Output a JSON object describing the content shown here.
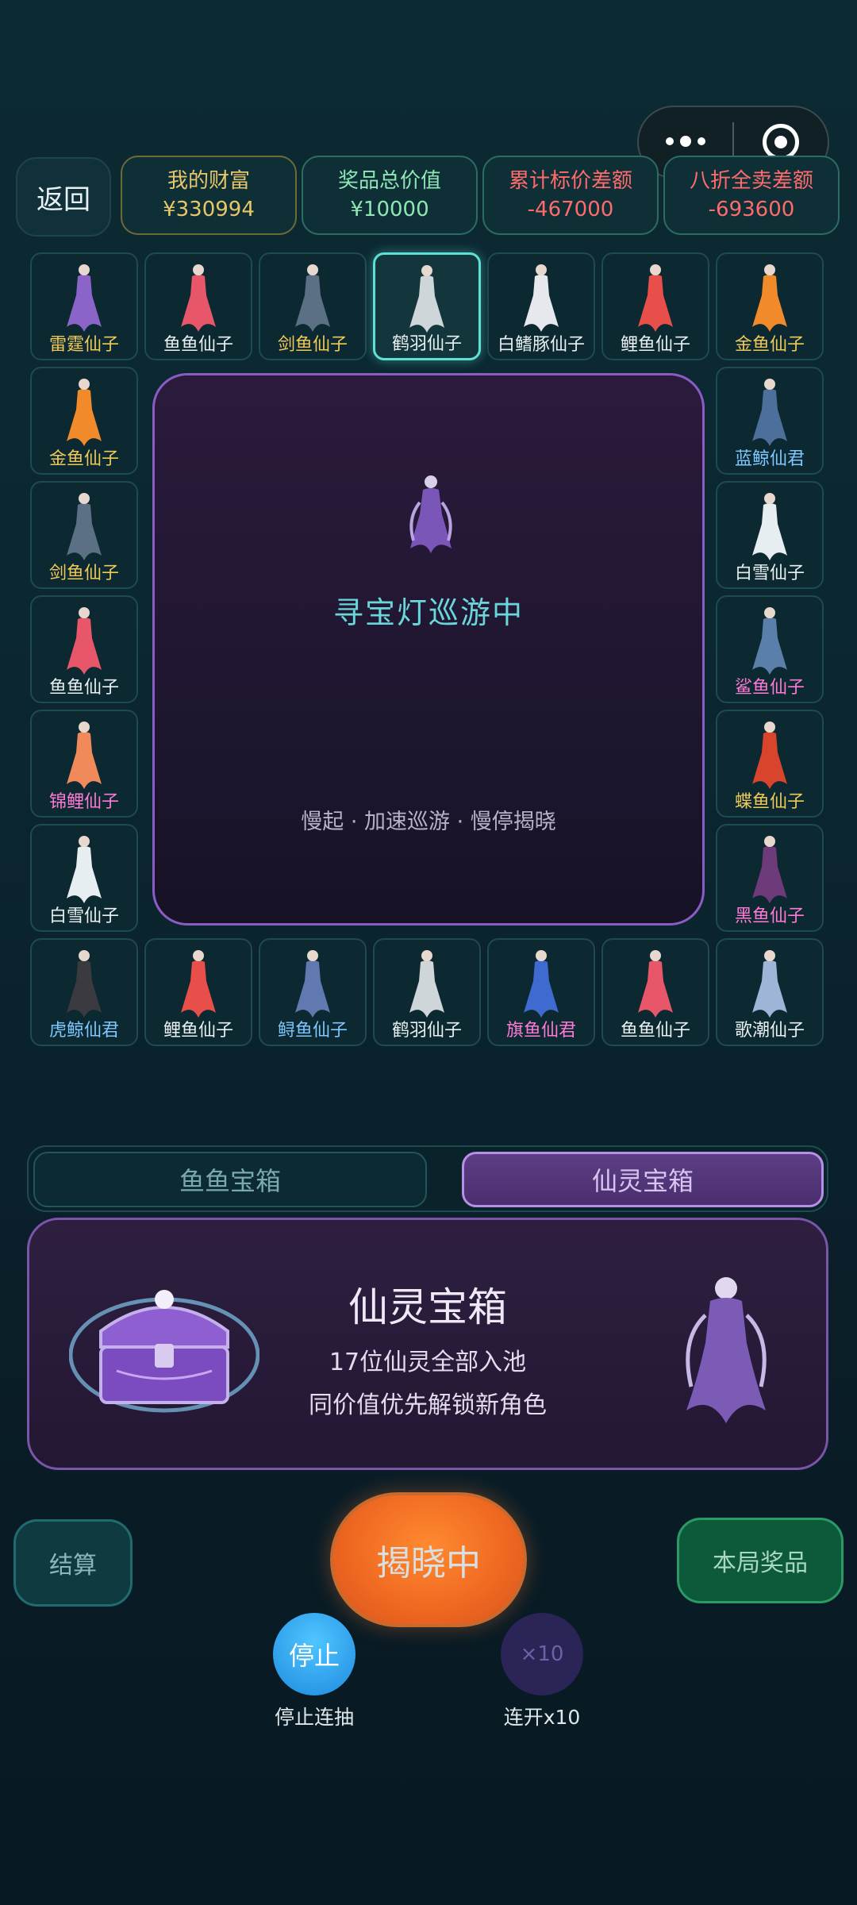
{
  "header": {
    "back_label": "返回",
    "stats": [
      {
        "label": "我的财富",
        "value": "¥330994"
      },
      {
        "label": "奖品总价值",
        "value": "¥10000"
      },
      {
        "label": "累计标价差额",
        "value": "-467000"
      },
      {
        "label": "八折全卖差额",
        "value": "-693600"
      }
    ]
  },
  "board": {
    "tiles": [
      {
        "name": "雷霆仙子",
        "color": "#f0c95a",
        "fig": "#8b64c9",
        "active": false
      },
      {
        "name": "鱼鱼仙子",
        "color": "#e9f1f2",
        "fig": "#e8566a",
        "active": false
      },
      {
        "name": "剑鱼仙子",
        "color": "#f0c95a",
        "fig": "#5b6f85",
        "active": false
      },
      {
        "name": "鹤羽仙子",
        "color": "#e9f1f2",
        "fig": "#cfd6da",
        "active": true
      },
      {
        "name": "白鳍豚仙子",
        "color": "#e9f1f2",
        "fig": "#e7e7ee",
        "active": false
      },
      {
        "name": "鲤鱼仙子",
        "color": "#e9f1f2",
        "fig": "#e84f4a",
        "active": false
      },
      {
        "name": "金鱼仙子",
        "color": "#f0c95a",
        "fig": "#f08a2a",
        "active": false
      },
      {
        "name": "蓝鲸仙君",
        "color": "#7ec8ff",
        "fig": "#4d6f9c",
        "active": false
      },
      {
        "name": "白雪仙子",
        "color": "#e9f1f2",
        "fig": "#e6eef2",
        "active": false
      },
      {
        "name": "鲨鱼仙子",
        "color": "#ff7ad6",
        "fig": "#5a7fa8",
        "active": false
      },
      {
        "name": "蝶鱼仙子",
        "color": "#f0c95a",
        "fig": "#d8452c",
        "active": false
      },
      {
        "name": "黑鱼仙子",
        "color": "#ff7ad6",
        "fig": "#6d3a7a",
        "active": false
      },
      {
        "name": "歌潮仙子",
        "color": "#e9f1f2",
        "fig": "#9fb5d8",
        "active": false
      },
      {
        "name": "鱼鱼仙子",
        "color": "#e9f1f2",
        "fig": "#e8566a",
        "active": false
      },
      {
        "name": "旗鱼仙君",
        "color": "#ff7ad6",
        "fig": "#3f6bd0",
        "active": false
      },
      {
        "name": "鹤羽仙子",
        "color": "#e9f1f2",
        "fig": "#cfd6da",
        "active": false
      },
      {
        "name": "鲟鱼仙子",
        "color": "#7ec8ff",
        "fig": "#6079b0",
        "active": false
      },
      {
        "name": "鲤鱼仙子",
        "color": "#e9f1f2",
        "fig": "#e84f4a",
        "active": false
      },
      {
        "name": "虎鲸仙君",
        "color": "#7ec8ff",
        "fig": "#3a3a40",
        "active": false
      },
      {
        "name": "白雪仙子",
        "color": "#e9f1f2",
        "fig": "#e6eef2",
        "active": false
      },
      {
        "name": "锦鲤仙子",
        "color": "#ff7ad6",
        "fig": "#f08a5a",
        "active": false
      },
      {
        "name": "鱼鱼仙子",
        "color": "#e9f1f2",
        "fig": "#e8566a",
        "active": false
      },
      {
        "name": "剑鱼仙子",
        "color": "#f0c95a",
        "fig": "#5b6f85",
        "active": false
      },
      {
        "name": "金鱼仙子",
        "color": "#f0c95a",
        "fig": "#f08a2a",
        "active": false
      }
    ],
    "center_title": "寻宝灯巡游中",
    "center_subtitle": "慢起 · 加速巡游 · 慢停揭晓"
  },
  "chest_tabs": [
    "鱼鱼宝箱",
    "仙灵宝箱"
  ],
  "chest_panel": {
    "title": "仙灵宝箱",
    "line1": "17位仙灵全部入池",
    "line2": "同价值优先解锁新角色"
  },
  "controls": {
    "settle_label": "结算",
    "reveal_label": "揭晓中",
    "prizes_label": "本局奖品",
    "stop_label": "停止",
    "stop_caption": "停止连抽",
    "x10_label": "×10",
    "x10_caption": "连开x10"
  },
  "colors": {
    "accent_cyan": "#5de0d6",
    "accent_purple": "#8a5cc5",
    "reveal_orange": "#f06a22"
  }
}
